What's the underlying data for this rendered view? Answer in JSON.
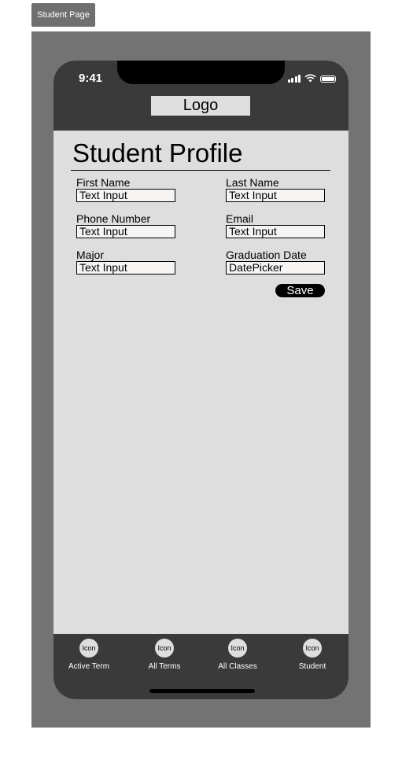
{
  "frame": {
    "label": "Student Page"
  },
  "status_bar": {
    "time": "9:41"
  },
  "header": {
    "logo": "Logo"
  },
  "main": {
    "title": "Student Profile",
    "fields": [
      {
        "label": "First Name",
        "value": "Text Input"
      },
      {
        "label": "Last Name",
        "value": "Text Input"
      },
      {
        "label": "Phone Number",
        "value": "Text Input"
      },
      {
        "label": "Email",
        "value": "Text Input"
      },
      {
        "label": "Major",
        "value": "Text Input"
      },
      {
        "label": "Graduation Date",
        "value": "DatePicker"
      }
    ],
    "save_label": "Save"
  },
  "tabbar": {
    "tabs": [
      {
        "icon": "Icon",
        "label": "Active Term"
      },
      {
        "icon": "Icon",
        "label": "All Terms"
      },
      {
        "icon": "Icon",
        "label": "All Classes"
      },
      {
        "icon": "Icon",
        "label": "Student"
      }
    ]
  }
}
